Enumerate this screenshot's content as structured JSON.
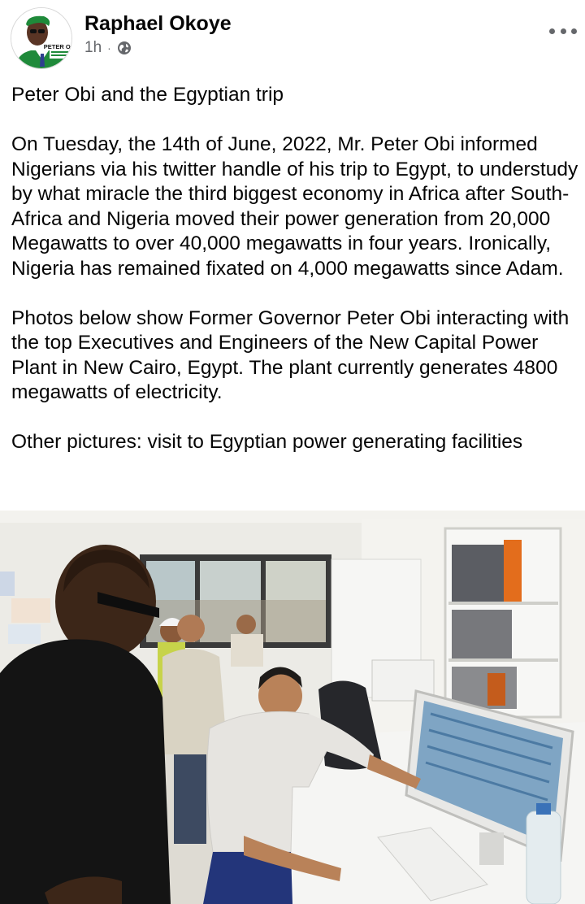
{
  "post": {
    "author": "Raphael Okoye",
    "time": "1h",
    "separator": "·",
    "privacy_icon": "globe-icon",
    "options_icon": "more-options-icon",
    "avatar_badge": "PETER OBI",
    "paragraphs": [
      "Peter Obi and the Egyptian trip",
      "On Tuesday, the 14th of June, 2022, Mr. Peter Obi informed Nigerians via his twitter handle of his trip to Egypt, to understudy by what miracle the third biggest economy in Africa after South-Africa and Nigeria moved their power generation from 20,000 Megawatts to over 40,000 megawatts in four years. Ironically, Nigeria has remained fixated on 4,000 megawatts since Adam.",
      "Photos below show Former Governor Peter Obi interacting with the top Executives and Engineers of the New Capital Power Plant in New Cairo, Egypt. The plant currently generates 4800 megawatts of electricity.",
      "Other pictures: visit to Egyptian power generating facilities"
    ]
  },
  "colors": {
    "text": "#050505",
    "secondary": "#65676b",
    "avatar_green": "#1f8a3a"
  }
}
